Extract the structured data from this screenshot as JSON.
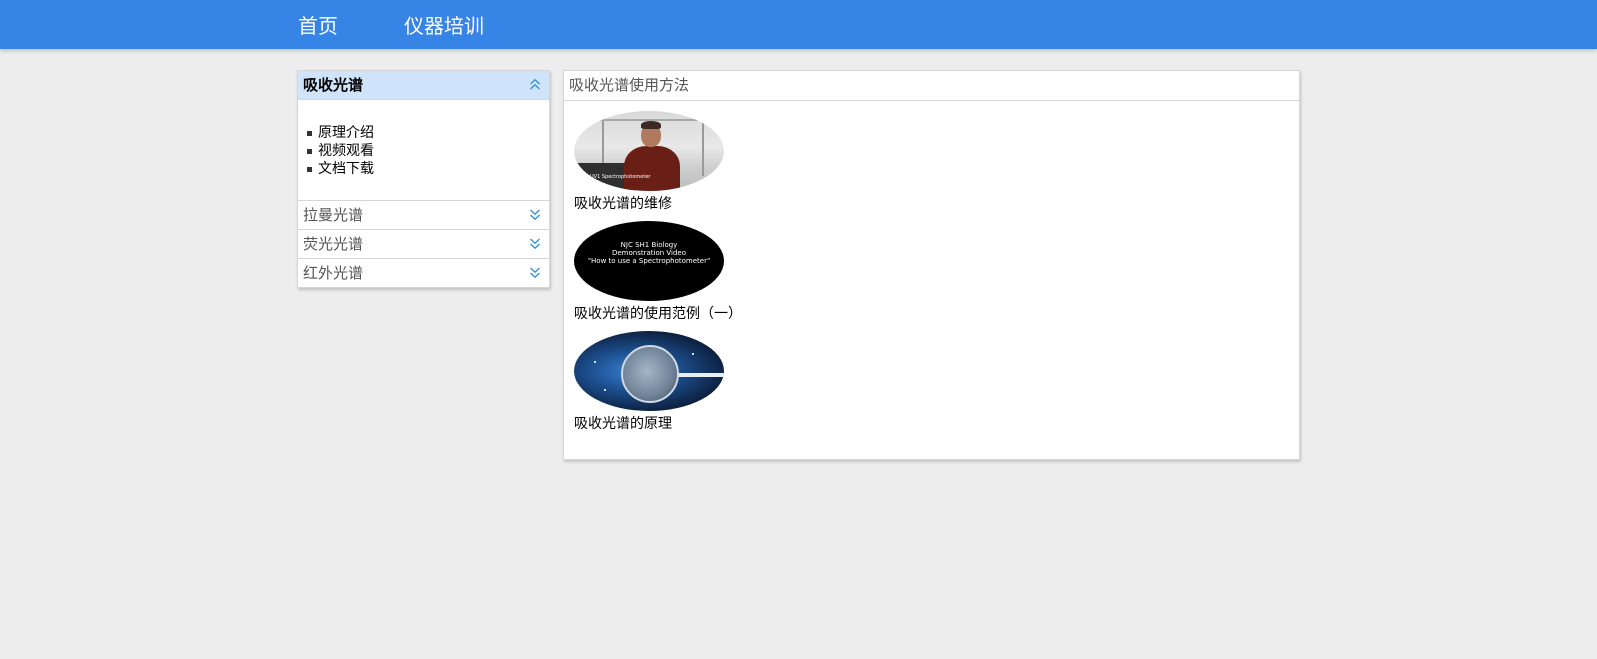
{
  "nav": {
    "home": "首页",
    "training": "仪器培训",
    "color": "#3784e7"
  },
  "sidebar": {
    "sections": [
      {
        "label": "吸收光谱",
        "expanded": true,
        "icon": "double-chevron-up-icon",
        "items": [
          {
            "label": "原理介绍"
          },
          {
            "label": "视频观看"
          },
          {
            "label": "文档下载"
          }
        ]
      },
      {
        "label": "拉曼光谱",
        "expanded": false,
        "icon": "double-chevron-down-icon"
      },
      {
        "label": "荧光光谱",
        "expanded": false,
        "icon": "double-chevron-down-icon"
      },
      {
        "label": "红外光谱",
        "expanded": false,
        "icon": "double-chevron-down-icon"
      }
    ],
    "active_color": "#cfe4fa"
  },
  "main": {
    "title": "吸收光谱使用方法",
    "videos": [
      {
        "caption": "吸收光谱的维修",
        "thumbnail": "lab-person",
        "thumb_text": "UV1 Spectrophotometer"
      },
      {
        "caption": "吸收光谱的使用范例（一）",
        "thumbnail": "title-card",
        "thumb_lines": [
          "NJC SH1 Biology",
          "Demonstration Video",
          "\"How to use a  Spectrophotometer\""
        ]
      },
      {
        "caption": "吸收光谱的原理",
        "thumbnail": "lens-space"
      }
    ]
  }
}
